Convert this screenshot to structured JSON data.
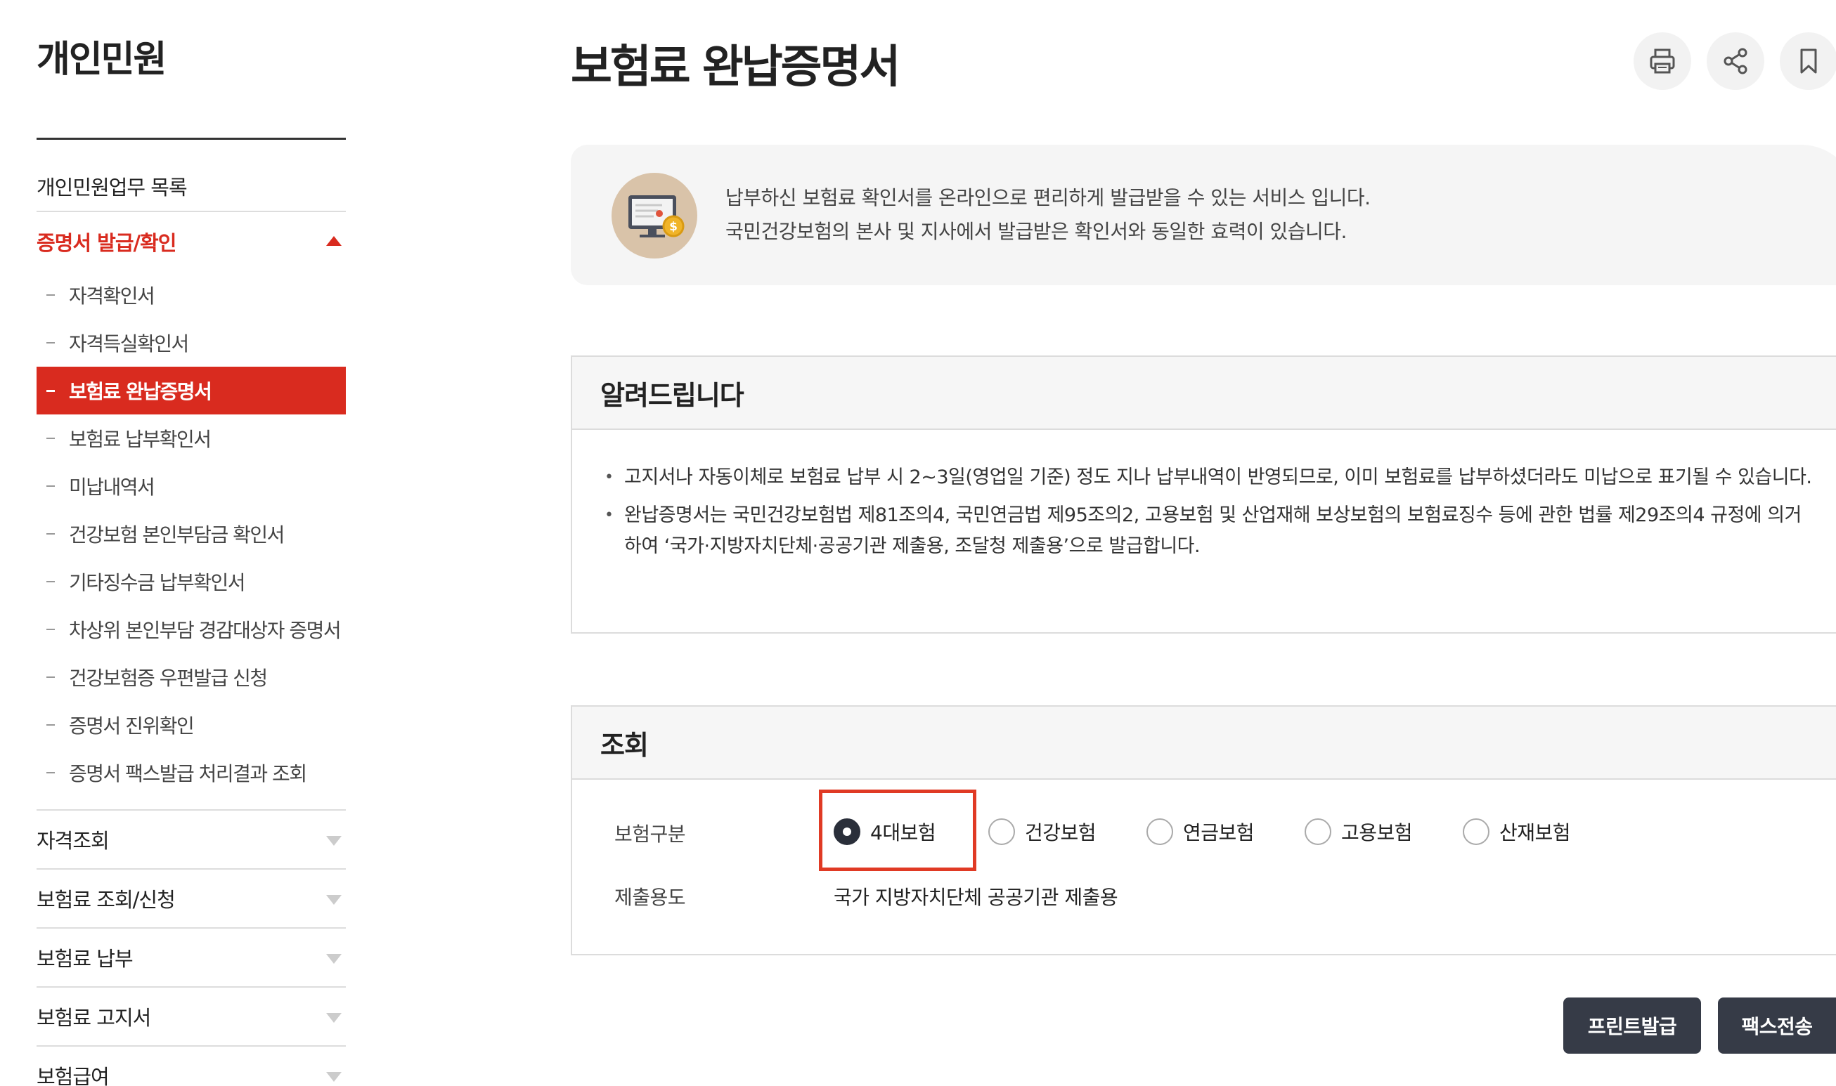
{
  "sidebar": {
    "title": "개인민원",
    "top_item": "개인민원업무 목록",
    "active_group": "증명서 발급/확인",
    "sub_items": [
      {
        "label": "자격확인서"
      },
      {
        "label": "자격득실확인서"
      },
      {
        "label": "보험료 완납증명서"
      },
      {
        "label": "보험료 납부확인서"
      },
      {
        "label": "미납내역서"
      },
      {
        "label": "건강보험 본인부담금 확인서"
      },
      {
        "label": "기타징수금 납부확인서"
      },
      {
        "label": "차상위 본인부담 경감대상자 증명서"
      },
      {
        "label": "건강보험증 우편발급 신청"
      },
      {
        "label": "증명서 진위확인"
      },
      {
        "label": "증명서 팩스발급 처리결과 조회"
      }
    ],
    "groups": [
      {
        "label": "자격조회"
      },
      {
        "label": "보험료 조회/신청"
      },
      {
        "label": "보험료 납부"
      },
      {
        "label": "보험료 고지서"
      },
      {
        "label": "보험급여"
      }
    ]
  },
  "header": {
    "title": "보험료 완납증명서",
    "tools": {
      "print": "print-icon",
      "share": "share-icon",
      "bookmark": "bookmark-icon"
    }
  },
  "intro": {
    "line1": "납부하신 보험료 확인서를 온라인으로 편리하게 발급받을 수 있는 서비스 입니다.",
    "line2": "국민건강보험의 본사 및 지사에서 발급받은 확인서와 동일한 효력이 있습니다."
  },
  "notice": {
    "title": "알려드립니다",
    "items": [
      "고지서나 자동이체로 보험료 납부 시 2~3일(영업일 기준) 정도 지나 납부내역이 반영되므로, 이미 보험료를 납부하셨더라도 미납으로 표기될 수 있습니다.",
      "완납증명서는 국민건강보험법 제81조의4, 국민연금법 제95조의2, 고용보험 및 산업재해 보상보험의 보험료징수 등에 관한 법률 제29조의4 규정에 의거하여 ‘국가·지방자치단체·공공기관 제출용, 조달청 제출용’으로 발급합니다."
    ]
  },
  "search": {
    "title": "조회",
    "insurance_type_label": "보험구분",
    "options": [
      {
        "label": "4대보험",
        "checked": true
      },
      {
        "label": "건강보험",
        "checked": false
      },
      {
        "label": "연금보험",
        "checked": false
      },
      {
        "label": "고용보험",
        "checked": false
      },
      {
        "label": "산재보험",
        "checked": false
      }
    ],
    "purpose_label": "제출용도",
    "purpose_value": "국가 지방자치단체 공공기관 제출용"
  },
  "actions": {
    "print_issue": "프린트발급",
    "fax_send": "팩스전송"
  },
  "colors": {
    "accent": "#d92b1f",
    "highlight": "#e03a24",
    "button_dark": "#363b47"
  }
}
